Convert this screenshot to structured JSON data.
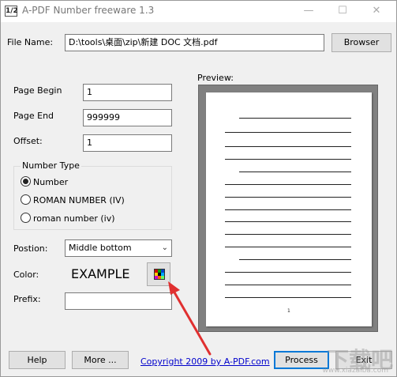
{
  "window": {
    "icon_text": "1/2",
    "title": "A-PDF Number freeware 1.3",
    "minimize": "—",
    "maximize": "☐",
    "close": "✕"
  },
  "file": {
    "label": "File Name:",
    "value": "D:\\tools\\桌面\\zip\\新建 DOC 文档.pdf",
    "browse_label": "Browser"
  },
  "fields": {
    "page_begin_label": "Page Begin",
    "page_begin_value": "1",
    "page_end_label": "Page End",
    "page_end_value": "999999",
    "offset_label": "Offset:",
    "offset_value": "1"
  },
  "number_type": {
    "title": "Number Type",
    "options": [
      "Number",
      "ROMAN NUMBER (IV)",
      "roman number (iv)"
    ],
    "selected": "Number"
  },
  "position": {
    "label": "Postion:",
    "value": "Middle bottom"
  },
  "color": {
    "label": "Color:",
    "example_text": "EXAMPLE",
    "palette": [
      "#cc0000",
      "#00a000",
      "#0044cc",
      "#ffcc00",
      "#000000",
      "#00aaff",
      "#cc00cc",
      "#ff6600",
      "#66ff66"
    ]
  },
  "prefix": {
    "label": "Prefix:",
    "value": ""
  },
  "preview": {
    "label": "Preview:",
    "page_number": "1"
  },
  "footer": {
    "help_label": "Help",
    "more_label": "More ...",
    "copyright": "Copyright 2009 by A-PDF.com",
    "process_label": "Process",
    "exit_label": "Exit"
  },
  "watermark": {
    "text": "下载吧",
    "sub": "www.xiazaiba.com"
  }
}
